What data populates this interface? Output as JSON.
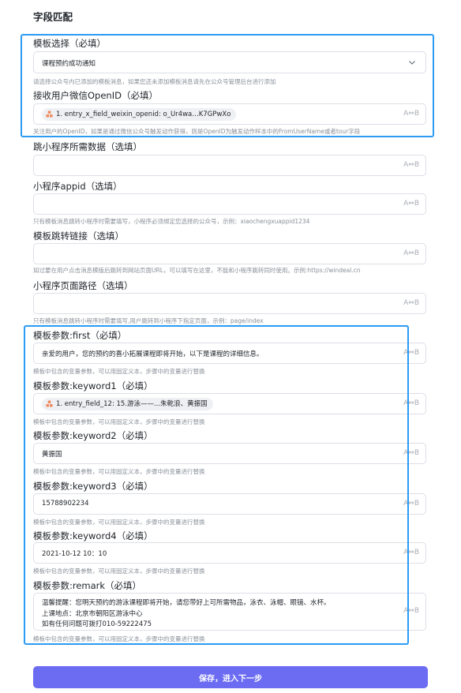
{
  "section_title": "字段匹配",
  "ab_icon_text": "A⇔B",
  "template_select": {
    "label": "模板选择（必填）",
    "value": "课程预约成功通知",
    "hint": "请选择公众号内已添加的模板消息，如果您还未添加模板消息请先在公众号管理后台进行添加"
  },
  "openid": {
    "label": "接收用户微信OpenID（必填）",
    "chip": "1. entry_x_field_weixin_openid: o_Ur4wa…K7GPwXo",
    "hint": "关注用户的OpenID，如果是通过微信公众号触发动作获得，则是OpenID为触发动作样本中的FromUserName或者tour字段"
  },
  "miniprogram_data": {
    "label": "跳小程序所需数据（选填）",
    "value": ""
  },
  "miniprogram_appid": {
    "label": "小程序appid（选填）",
    "value": "",
    "hint": "只有模板消息跳转小程序时需要填写，小程序必须绑定您选择的公众号，示例：xiaochengxuappid1234"
  },
  "template_link": {
    "label": "模板跳转链接（选填）",
    "value": "",
    "hint": "如过要在用户点击消息模版后跳转到网站页面URL，可以填写在这里，不能和小程序跳转同时使用。示例:https://windeal.cn"
  },
  "miniprogram_path": {
    "label": "小程序页面路径（选填）",
    "value": "",
    "hint": "只有模板消息跳转小程序时需要填写,用户跳转到小程序下指定页面，示例：page/index"
  },
  "param_first": {
    "label": "模板参数:first（必填）",
    "value": "亲爱的用户，您的预约的喜小拓展课程即将开始，以下是课程的详细信息。",
    "hint": "模板中包含的变量参数，可以用固定义本，步骤中的变量进行替换"
  },
  "param_keyword1": {
    "label": "模板参数:keyword1（必填）",
    "chip": "1. entry_field_12: 15.游泳——...朱乾浪、黄振国",
    "hint": "模板中包含的变量参数，可以用固定义本，步骤中的变量进行替换"
  },
  "param_keyword2": {
    "label": "模板参数:keyword2（必填）",
    "value": "黄振国",
    "hint": "模板中包含的变量参数，可以用固定义本，步骤中的变量进行替换"
  },
  "param_keyword3": {
    "label": "模板参数:keyword3（必填）",
    "value": "15788902234",
    "hint": "模板中包含的变量参数，可以用固定义本，步骤中的变量进行替换"
  },
  "param_keyword4": {
    "label": "模板参数:keyword4（必填）",
    "value": "2021-10-12 10：10",
    "hint": "模板中包含的变量参数，可以用固定义本，步骤中的变量进行替换"
  },
  "param_remark": {
    "label": "模板参数:remark（必填）",
    "lines": [
      "温馨提醒：您明天预约的游泳课程即将开始，请您带好上可所需物品，泳衣、泳帽、眼镜、水杯。",
      "上课地点：北京市朝阳区游泳中心",
      "如有任何问题可拨打010-59222475"
    ],
    "hint": "模板中包含的变量参数，可以用固定义本，步骤中的变量进行替换"
  },
  "save_button": "保存，进入下一步",
  "colors": {
    "accent": "#6b6cf2",
    "highlight_frame": "#2b9bf4",
    "chip_bg": "#eef0f4",
    "chip_icon": "#f08a5d"
  }
}
